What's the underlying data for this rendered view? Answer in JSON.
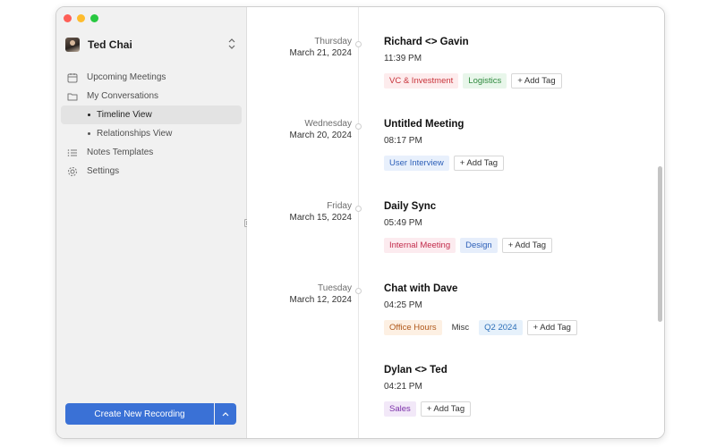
{
  "window": {
    "traffic_lights": {
      "close": "#fe5f57",
      "minimize": "#febc2e",
      "zoom": "#28c840"
    }
  },
  "sidebar": {
    "user": {
      "name": "Ted Chai"
    },
    "nav": {
      "upcoming": "Upcoming Meetings",
      "conversations": "My Conversations",
      "timeline": "Timeline View",
      "relationships": "Relationships View",
      "templates": "Notes Templates",
      "settings": "Settings"
    },
    "record_button": "Create New Recording"
  },
  "accent_color": "#3a71d6",
  "timeline": [
    {
      "dow": "Thursday",
      "date": "March 21, 2024",
      "title": "Richard <> Gavin",
      "time": "11:39 PM",
      "tags": [
        {
          "label": "VC & Investment",
          "color": "#c8333a",
          "bg": "#fdeced"
        },
        {
          "label": "Logistics",
          "color": "#2f8a3e",
          "bg": "#e8f6ea"
        }
      ]
    },
    {
      "dow": "Wednesday",
      "date": "March 20, 2024",
      "title": "Untitled Meeting",
      "time": "08:17 PM",
      "tags": [
        {
          "label": "User Interview",
          "color": "#2c5fb8",
          "bg": "#e8f0fc"
        }
      ]
    },
    {
      "dow": "Friday",
      "date": "March 15, 2024",
      "title": "Daily Sync",
      "time": "05:49 PM",
      "tags": [
        {
          "label": "Internal Meeting",
          "color": "#c22a4a",
          "bg": "#fcebef"
        },
        {
          "label": "Design",
          "color": "#2c5fb8",
          "bg": "#e6eefb"
        }
      ]
    },
    {
      "dow": "Tuesday",
      "date": "March 12, 2024",
      "title": "Chat with Dave",
      "time": "04:25 PM",
      "tags": [
        {
          "label": "Office Hours",
          "color": "#b0581a",
          "bg": "#fdf0e3"
        },
        {
          "label": "Misc",
          "color": "#333333",
          "bg": "transparent"
        },
        {
          "label": "Q2 2024",
          "color": "#2c6fb8",
          "bg": "#e6f1fb"
        }
      ]
    },
    {
      "dow": "",
      "date": "",
      "title": "Dylan <> Ted",
      "time": "04:21 PM",
      "tags": [
        {
          "label": "Sales",
          "color": "#7a2fa8",
          "bg": "#f2e8f8"
        }
      ]
    }
  ],
  "add_tag_label": "+ Add Tag"
}
